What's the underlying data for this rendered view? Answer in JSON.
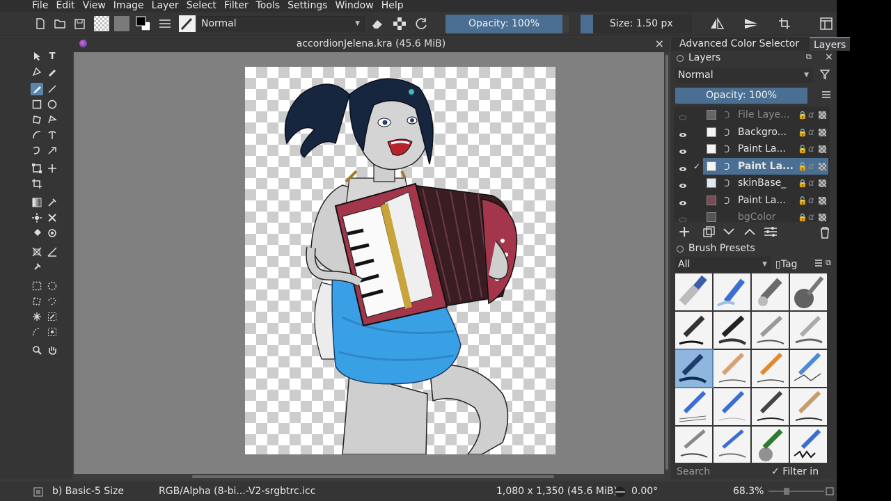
{
  "menubar": {
    "items": [
      "File",
      "Edit",
      "View",
      "Image",
      "Layer",
      "Select",
      "Filter",
      "Tools",
      "Settings",
      "Window",
      "Help"
    ]
  },
  "toolbar": {
    "blend_mode": "Normal",
    "opacity": "Opacity: 100%",
    "size": "Size: 1.50 px"
  },
  "document": {
    "tab_title": "accordionJelena.kra (45.6 MiB)"
  },
  "dock": {
    "tabs": [
      "Advanced Color Selector",
      "Layers"
    ],
    "layers_panel": {
      "title": "Layers",
      "blend_mode": "Normal",
      "opacity": "Opacity:  100%",
      "layers": [
        {
          "name": "File Laye...",
          "faded": true
        },
        {
          "name": "Backgro...",
          "faded": false
        },
        {
          "name": "Paint La...",
          "faded": false
        },
        {
          "name": "Paint La...",
          "faded": false,
          "selected": true
        },
        {
          "name": "skinBase_",
          "faded": false
        },
        {
          "name": "Paint La...",
          "faded": false
        },
        {
          "name": "bgColor",
          "faded": true
        }
      ]
    },
    "brush_panel": {
      "title": "Brush Presets",
      "filter": "All",
      "tag_button": "Tag",
      "search_placeholder": "Search",
      "filter_in_tag": "Filter in Tag"
    }
  },
  "statusbar": {
    "brush": "b) Basic-5 Size",
    "color_profile": "RGB/Alpha (8-bi...-V2-srgbtrc.icc",
    "image_size": "1,080 x 1,350 (45.6 MiB)",
    "rotation": "0.00°",
    "zoom": "68.3%"
  },
  "colors": {
    "accent": "#5a84ad",
    "slider_fill": "#4a6f93",
    "canvas_bg": "#808080",
    "dress": "#3aa0e6",
    "accordion": "#a3364a"
  }
}
